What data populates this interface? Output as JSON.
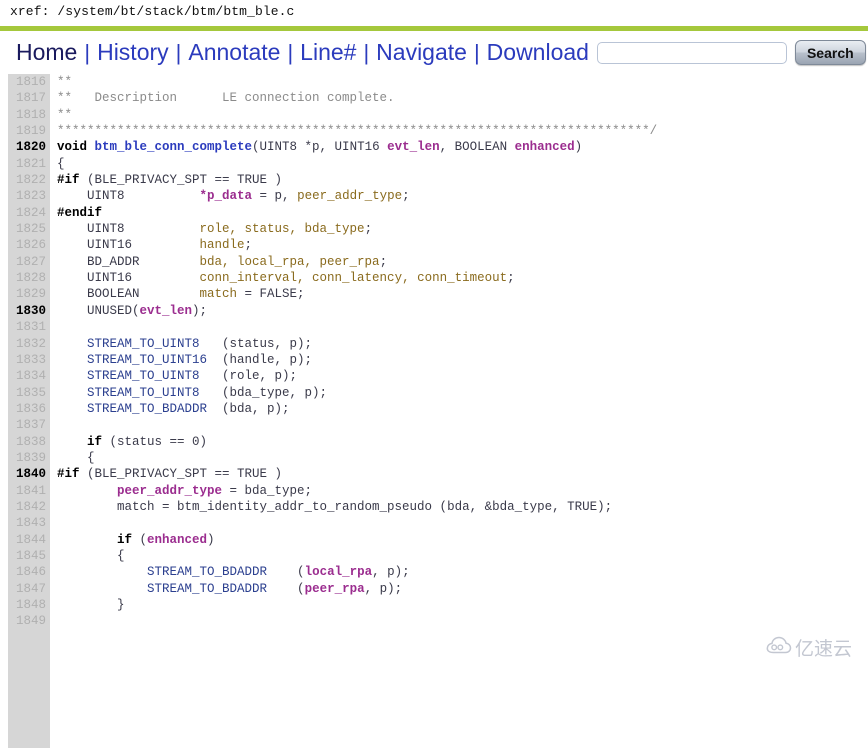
{
  "header": {
    "xref_label": "xref: /system/bt/stack/btm/btm_ble.c",
    "accent_color": "#a5c83c"
  },
  "nav": {
    "links": [
      {
        "label": "Home",
        "name": "nav-home"
      },
      {
        "label": "History",
        "name": "nav-history"
      },
      {
        "label": "Annotate",
        "name": "nav-annotate"
      },
      {
        "label": "Line#",
        "name": "nav-linenumber"
      },
      {
        "label": "Navigate",
        "name": "nav-navigate"
      },
      {
        "label": "Download",
        "name": "nav-download"
      }
    ],
    "separator": "|",
    "search": {
      "value": "",
      "placeholder": "",
      "button_label": "Search"
    },
    "link_color": "#2b3bbd"
  },
  "code": {
    "first_line": 1816,
    "lines": [
      {
        "n": 1816,
        "tokens": [
          {
            "t": "**",
            "c": "cmt"
          }
        ]
      },
      {
        "n": 1817,
        "tokens": [
          {
            "t": "**   Description      LE connection complete.",
            "c": "cmt"
          }
        ]
      },
      {
        "n": 1818,
        "tokens": [
          {
            "t": "**",
            "c": "cmt"
          }
        ]
      },
      {
        "n": 1819,
        "tokens": [
          {
            "t": "*******************************************************************************/",
            "c": "cmt"
          }
        ]
      },
      {
        "n": 1820,
        "tokens": [
          {
            "t": "void ",
            "c": "kw"
          },
          {
            "t": "btm_ble_conn_complete",
            "c": "fn"
          },
          {
            "t": "(UINT8 *p, UINT16 ",
            "c": "pln"
          },
          {
            "t": "evt_len",
            "c": "var"
          },
          {
            "t": ", BOOLEAN ",
            "c": "pln"
          },
          {
            "t": "enhanced",
            "c": "var"
          },
          {
            "t": ")",
            "c": "pln"
          }
        ]
      },
      {
        "n": 1821,
        "tokens": [
          {
            "t": "{",
            "c": "pln"
          }
        ]
      },
      {
        "n": 1822,
        "tokens": [
          {
            "t": "#if ",
            "c": "kw"
          },
          {
            "t": "(BLE_PRIVACY_SPT == TRUE )",
            "c": "pln"
          }
        ]
      },
      {
        "n": 1823,
        "tokens": [
          {
            "t": "    UINT8          ",
            "c": "pln"
          },
          {
            "t": "*p_data",
            "c": "var"
          },
          {
            "t": " = p, ",
            "c": "pln"
          },
          {
            "t": "peer_addr_type",
            "c": "decl"
          },
          {
            "t": ";",
            "c": "pln"
          }
        ]
      },
      {
        "n": 1824,
        "tokens": [
          {
            "t": "#endif",
            "c": "kw"
          }
        ]
      },
      {
        "n": 1825,
        "tokens": [
          {
            "t": "    UINT8          ",
            "c": "pln"
          },
          {
            "t": "role, status, bda_type",
            "c": "decl"
          },
          {
            "t": ";",
            "c": "pln"
          }
        ]
      },
      {
        "n": 1826,
        "tokens": [
          {
            "t": "    UINT16         ",
            "c": "pln"
          },
          {
            "t": "handle",
            "c": "decl"
          },
          {
            "t": ";",
            "c": "pln"
          }
        ]
      },
      {
        "n": 1827,
        "tokens": [
          {
            "t": "    BD_ADDR        ",
            "c": "pln"
          },
          {
            "t": "bda, local_rpa, peer_rpa",
            "c": "decl"
          },
          {
            "t": ";",
            "c": "pln"
          }
        ]
      },
      {
        "n": 1828,
        "tokens": [
          {
            "t": "    UINT16         ",
            "c": "pln"
          },
          {
            "t": "conn_interval, conn_latency, conn_timeout",
            "c": "decl"
          },
          {
            "t": ";",
            "c": "pln"
          }
        ]
      },
      {
        "n": 1829,
        "tokens": [
          {
            "t": "    BOOLEAN        ",
            "c": "pln"
          },
          {
            "t": "match",
            "c": "decl"
          },
          {
            "t": " = FALSE;",
            "c": "pln"
          }
        ]
      },
      {
        "n": 1830,
        "tokens": [
          {
            "t": "    UNUSED(",
            "c": "pln"
          },
          {
            "t": "evt_len",
            "c": "var"
          },
          {
            "t": ");",
            "c": "pln"
          }
        ]
      },
      {
        "n": 1831,
        "tokens": [
          {
            "t": "",
            "c": "pln"
          }
        ]
      },
      {
        "n": 1832,
        "tokens": [
          {
            "t": "    STREAM_TO_UINT8 ",
            "c": "mac"
          },
          {
            "t": "  (status, p);",
            "c": "pln"
          }
        ]
      },
      {
        "n": 1833,
        "tokens": [
          {
            "t": "    STREAM_TO_UINT16",
            "c": "mac"
          },
          {
            "t": "  (handle, p);",
            "c": "pln"
          }
        ]
      },
      {
        "n": 1834,
        "tokens": [
          {
            "t": "    STREAM_TO_UINT8 ",
            "c": "mac"
          },
          {
            "t": "  (role, p);",
            "c": "pln"
          }
        ]
      },
      {
        "n": 1835,
        "tokens": [
          {
            "t": "    STREAM_TO_UINT8 ",
            "c": "mac"
          },
          {
            "t": "  (bda_type, p);",
            "c": "pln"
          }
        ]
      },
      {
        "n": 1836,
        "tokens": [
          {
            "t": "    STREAM_TO_BDADDR",
            "c": "mac"
          },
          {
            "t": "  (bda, p);",
            "c": "pln"
          }
        ]
      },
      {
        "n": 1837,
        "tokens": [
          {
            "t": "",
            "c": "pln"
          }
        ]
      },
      {
        "n": 1838,
        "tokens": [
          {
            "t": "    if ",
            "c": "kw"
          },
          {
            "t": "(status == 0)",
            "c": "pln"
          }
        ]
      },
      {
        "n": 1839,
        "tokens": [
          {
            "t": "    {",
            "c": "pln"
          }
        ]
      },
      {
        "n": 1840,
        "tokens": [
          {
            "t": "#if ",
            "c": "kw"
          },
          {
            "t": "(BLE_PRIVACY_SPT == TRUE )",
            "c": "pln"
          }
        ]
      },
      {
        "n": 1841,
        "tokens": [
          {
            "t": "        ",
            "c": "pln"
          },
          {
            "t": "peer_addr_type",
            "c": "var"
          },
          {
            "t": " = bda_type;",
            "c": "pln"
          }
        ]
      },
      {
        "n": 1842,
        "tokens": [
          {
            "t": "        match = btm_identity_addr_to_random_pseudo (bda, &bda_type, TRUE);",
            "c": "pln"
          }
        ]
      },
      {
        "n": 1843,
        "tokens": [
          {
            "t": "",
            "c": "pln"
          }
        ]
      },
      {
        "n": 1844,
        "tokens": [
          {
            "t": "        if ",
            "c": "kw"
          },
          {
            "t": "(",
            "c": "pln"
          },
          {
            "t": "enhanced",
            "c": "var"
          },
          {
            "t": ")",
            "c": "pln"
          }
        ]
      },
      {
        "n": 1845,
        "tokens": [
          {
            "t": "        {",
            "c": "pln"
          }
        ]
      },
      {
        "n": 1846,
        "tokens": [
          {
            "t": "            STREAM_TO_BDADDR",
            "c": "mac"
          },
          {
            "t": "    (",
            "c": "pln"
          },
          {
            "t": "local_rpa",
            "c": "var"
          },
          {
            "t": ", p);",
            "c": "pln"
          }
        ]
      },
      {
        "n": 1847,
        "tokens": [
          {
            "t": "            STREAM_TO_BDADDR",
            "c": "mac"
          },
          {
            "t": "    (",
            "c": "pln"
          },
          {
            "t": "peer_rpa",
            "c": "var"
          },
          {
            "t": ", p);",
            "c": "pln"
          }
        ]
      },
      {
        "n": 1848,
        "tokens": [
          {
            "t": "        }",
            "c": "pln"
          }
        ]
      },
      {
        "n": 1849,
        "tokens": [
          {
            "t": "",
            "c": "pln"
          }
        ]
      }
    ],
    "major_line_step": 10,
    "gutter_color": "#d6d6d6"
  },
  "watermark": {
    "text": "亿速云",
    "icon": "cloud-icon"
  }
}
